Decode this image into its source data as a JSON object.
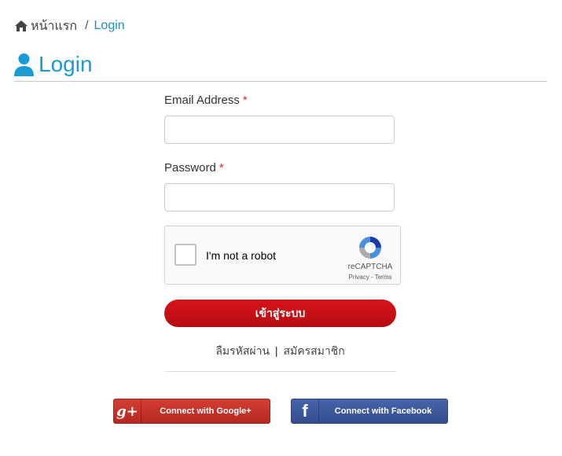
{
  "breadcrumb": {
    "home_label": "หน้าแรก",
    "separator": "/",
    "current": "Login"
  },
  "page": {
    "title": "Login"
  },
  "form": {
    "email_label": "Email Address",
    "password_label": "Password",
    "required_mark": "*",
    "email_value": "",
    "password_value": "",
    "submit_label": "เข้าสู่ระบบ",
    "forgot_label": "ลืมรหัสผ่าน",
    "links_separator": "|",
    "register_label": "สมัครสมาชิก"
  },
  "recaptcha": {
    "checkbox_label": "I'm not a robot",
    "brand": "reCAPTCHA",
    "privacy": "Privacy",
    "links_separator": "-",
    "terms": "Terms"
  },
  "social": {
    "google_label": "Connect with Google+",
    "google_icon": "g+",
    "facebook_label": "Connect with Facebook",
    "facebook_icon": "f"
  },
  "colors": {
    "accent": "#1a9bd6",
    "submit": "#c8101a",
    "google": "#c8352b",
    "facebook": "#3b5597"
  }
}
